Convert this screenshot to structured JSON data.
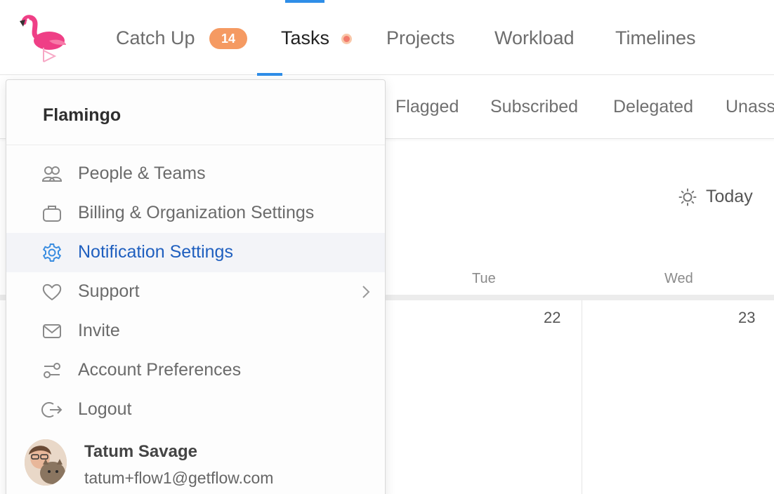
{
  "nav": {
    "items": [
      {
        "label": "Catch Up"
      },
      {
        "label": "Tasks"
      },
      {
        "label": "Projects"
      },
      {
        "label": "Workload"
      },
      {
        "label": "Timelines"
      }
    ],
    "catchup_badge": "14",
    "active_item": "Tasks",
    "accent_color": "#2f8ee8",
    "badge_color": "#f59a62",
    "logo_icon": "flamingo-logo"
  },
  "subtabs": {
    "items": [
      {
        "label": "Flagged"
      },
      {
        "label": "Subscribed"
      },
      {
        "label": "Delegated"
      },
      {
        "label": "Unass"
      }
    ]
  },
  "calendar": {
    "today_label": "Today",
    "today_icon": "sun-icon",
    "days": [
      {
        "name": "Tue",
        "number": "22"
      },
      {
        "name": "Wed",
        "number": "23"
      }
    ]
  },
  "menu": {
    "title": "Flamingo",
    "items": [
      {
        "label": "People & Teams",
        "icon": "people-icon"
      },
      {
        "label": "Billing & Organization Settings",
        "icon": "briefcase-icon"
      },
      {
        "label": "Notification Settings",
        "icon": "gear-icon",
        "selected": true
      },
      {
        "label": "Support",
        "icon": "heart-icon",
        "has_submenu": true
      },
      {
        "label": "Invite",
        "icon": "envelope-icon"
      },
      {
        "label": "Account Preferences",
        "icon": "sliders-icon"
      },
      {
        "label": "Logout",
        "icon": "logout-icon"
      }
    ],
    "selected_color": "#1f5fbf",
    "user": {
      "name": "Tatum Savage",
      "email": "tatum+flow1@getflow.com"
    }
  }
}
